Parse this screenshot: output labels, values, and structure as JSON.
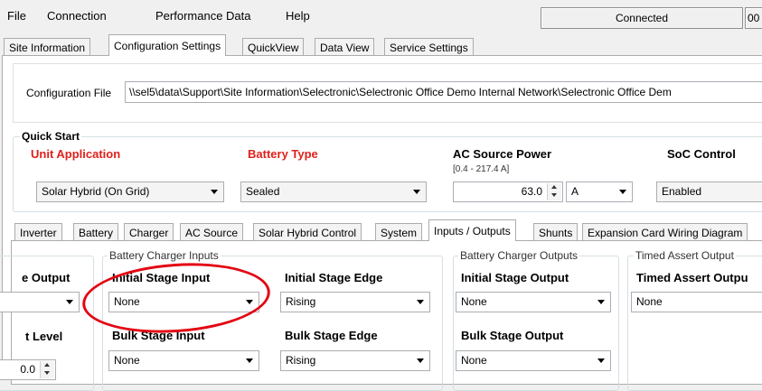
{
  "menu": {
    "file": "File",
    "connection": "Connection",
    "performance_data": "Performance Data",
    "help": "Help",
    "status": "Connected",
    "status2": "00"
  },
  "top_tabs": [
    "Site Information",
    "Configuration Settings",
    "QuickView",
    "Data View",
    "Service Settings"
  ],
  "config_file": {
    "label": "Configuration File",
    "value": "\\\\sel5\\data\\Support\\Site Information\\Selectronic\\Selectronic Office Demo Internal Network\\Selectronic Office Dem"
  },
  "quick_start": {
    "title": "Quick Start",
    "unit_application": {
      "label": "Unit Application",
      "value": "Solar Hybrid (On Grid)"
    },
    "battery_type": {
      "label": "Battery Type",
      "value": "Sealed"
    },
    "ac_source_power": {
      "label": "AC Source Power",
      "range": "[0.4 - 217.4 A]",
      "value": "63.0",
      "unit": "A"
    },
    "soc_control": {
      "label": "SoC Control",
      "value": "Enabled"
    }
  },
  "lower_tabs": [
    "Inverter",
    "Battery",
    "Charger",
    "AC Source",
    "Solar Hybrid Control",
    "System",
    "Inputs / Outputs",
    "Shunts",
    "Expansion Card Wiring Diagram"
  ],
  "left_partial": {
    "stage_output_label": "e Output",
    "level_label": "t Level",
    "level_value": "0.0"
  },
  "charger_inputs": {
    "title": "Battery Charger Inputs",
    "initial_stage_input": {
      "label": "Initial Stage Input",
      "value": "None"
    },
    "initial_stage_edge": {
      "label": "Initial Stage Edge",
      "value": "Rising"
    },
    "bulk_stage_input": {
      "label": "Bulk Stage Input",
      "value": "None"
    },
    "bulk_stage_edge": {
      "label": "Bulk Stage Edge",
      "value": "Rising"
    }
  },
  "charger_outputs": {
    "title": "Battery Charger Outputs",
    "initial_stage_output": {
      "label": "Initial Stage Output",
      "value": "None"
    },
    "bulk_stage_output": {
      "label": "Bulk Stage Output",
      "value": "None"
    }
  },
  "timed_assert": {
    "title": "Timed Assert Output",
    "label": "Timed Assert Outpu",
    "value": "None"
  },
  "colors": {
    "required_label": "#e0201b",
    "highlight_ellipse": "#e30613"
  }
}
